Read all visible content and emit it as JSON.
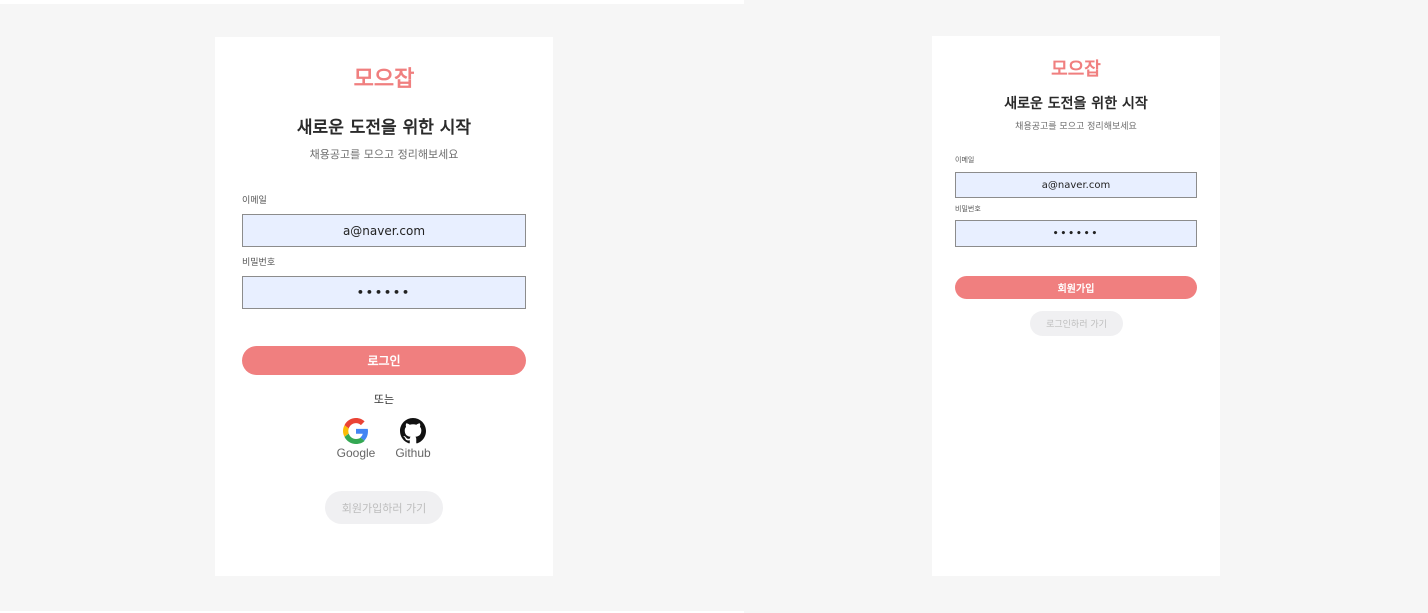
{
  "login": {
    "brand": "모으잡",
    "headline": "새로운 도전을 위한 시작",
    "subtitle": "채용공고를 모으고 정리해보세요",
    "email_label": "이메일",
    "email_value": "a@naver.com",
    "password_label": "비밀번호",
    "password_value": "••••••",
    "submit_label": "로그인",
    "divider_text": "또는",
    "social": [
      {
        "label": "Google",
        "icon": "google-icon"
      },
      {
        "label": "Github",
        "icon": "github-icon"
      }
    ],
    "switch_label": "회원가입하러 가기"
  },
  "signup": {
    "brand": "모으잡",
    "headline": "새로운 도전을 위한 시작",
    "subtitle": "채용공고를 모으고 정리해보세요",
    "email_label": "이메일",
    "email_value": "a@naver.com",
    "password_label": "비밀번호",
    "password_value": "••••••",
    "submit_label": "회원가입",
    "switch_label": "로그인하러 가기"
  },
  "colors": {
    "accent": "#f07f7f",
    "field_bg": "#e8efff",
    "page_bg": "#f6f6f6"
  }
}
